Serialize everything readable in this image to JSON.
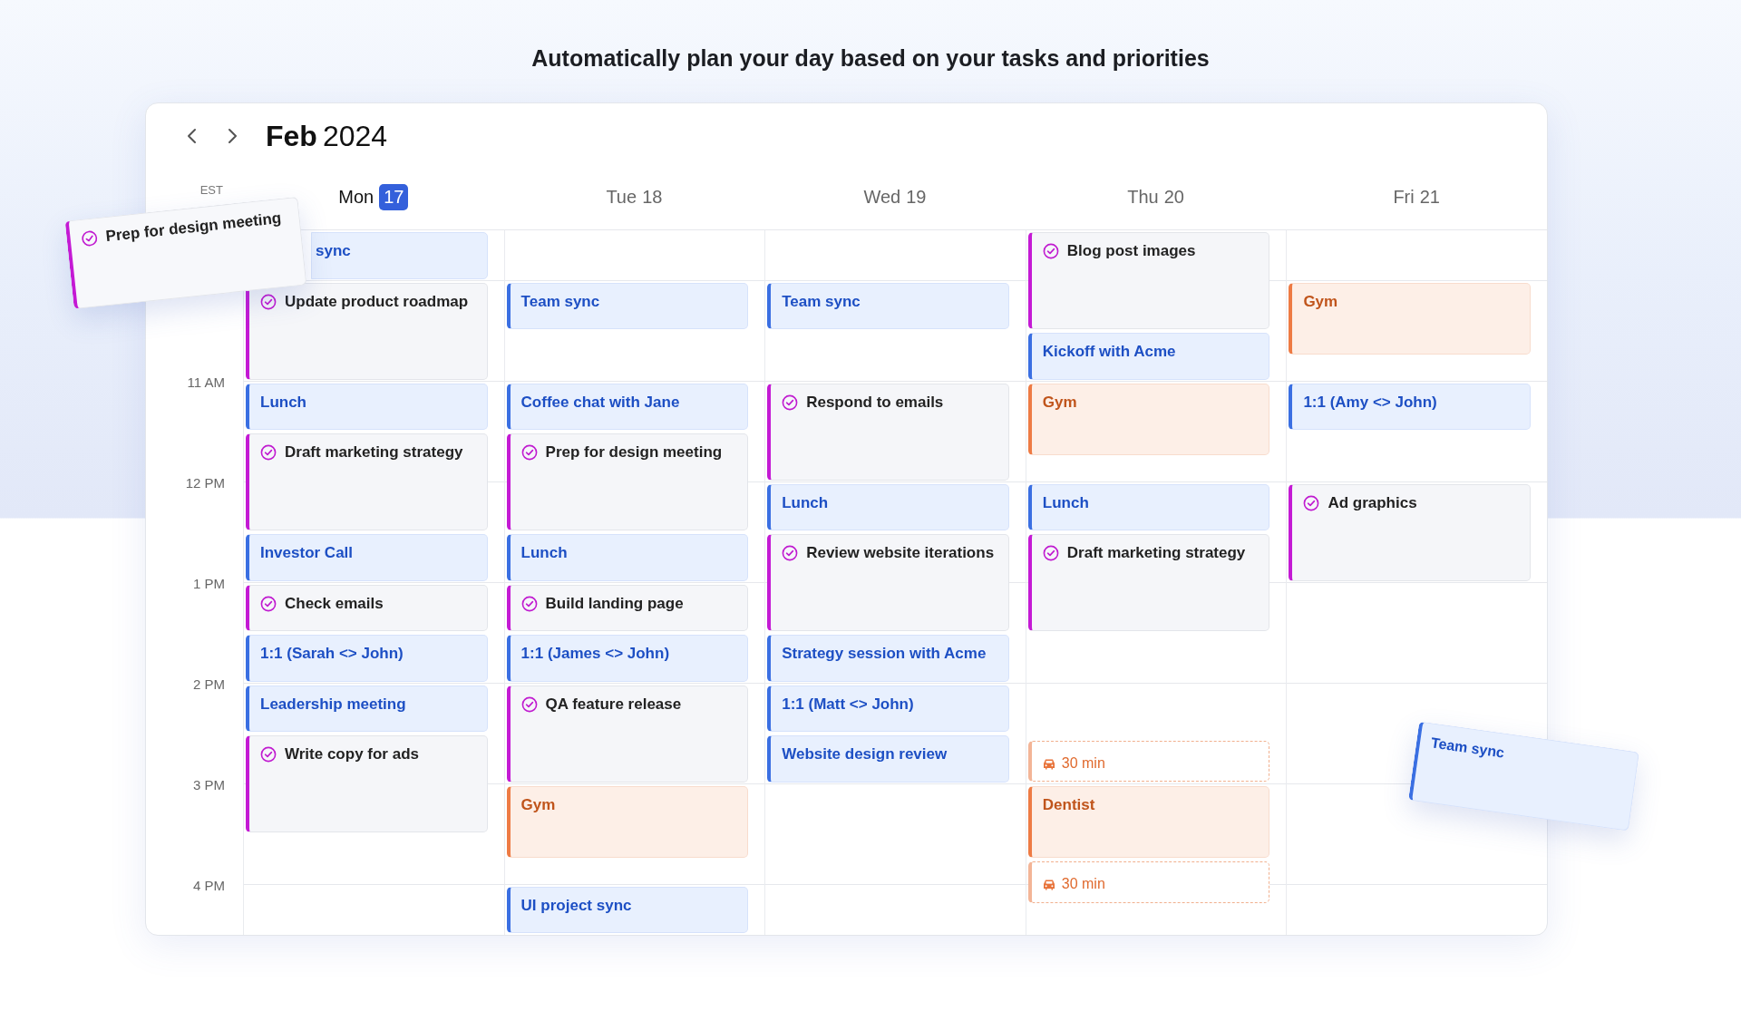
{
  "headline": "Automatically plan your day based on your tasks and priorities",
  "calendar": {
    "month": "Feb",
    "year": "2024",
    "timezone": "EST",
    "hours": [
      "11 AM",
      "12 PM",
      "1 PM",
      "2 PM",
      "3 PM",
      "4 PM"
    ],
    "days": [
      {
        "name": "Mon",
        "date": "17",
        "today": true,
        "events": [
          {
            "kind": "meeting",
            "title": "sync",
            "clipped": true
          },
          {
            "kind": "task",
            "title": "Update product roadmap"
          },
          {
            "kind": "meeting",
            "title": "Lunch"
          },
          {
            "kind": "task",
            "title": "Draft marketing strategy"
          },
          {
            "kind": "meeting",
            "title": "Investor Call"
          },
          {
            "kind": "task",
            "title": "Check emails"
          },
          {
            "kind": "meeting",
            "title": "1:1 (Sarah <> John)"
          },
          {
            "kind": "meeting",
            "title": "Leadership meeting"
          },
          {
            "kind": "task",
            "title": "Write copy for ads"
          }
        ]
      },
      {
        "name": "Tue",
        "date": "18",
        "today": false,
        "events": [
          {
            "kind": "meeting",
            "title": "Team sync"
          },
          {
            "kind": "meeting",
            "title": "Coffee chat with Jane"
          },
          {
            "kind": "task",
            "title": "Prep for design meeting"
          },
          {
            "kind": "meeting",
            "title": "Lunch"
          },
          {
            "kind": "task",
            "title": "Build landing page"
          },
          {
            "kind": "meeting",
            "title": "1:1 (James <> John)"
          },
          {
            "kind": "task",
            "title": "QA feature release"
          },
          {
            "kind": "personal",
            "title": "Gym"
          },
          {
            "kind": "meeting",
            "title": "UI project sync"
          }
        ]
      },
      {
        "name": "Wed",
        "date": "19",
        "today": false,
        "events": [
          {
            "kind": "meeting",
            "title": "Team sync"
          },
          {
            "kind": "task",
            "title": "Respond to emails"
          },
          {
            "kind": "meeting",
            "title": "Lunch"
          },
          {
            "kind": "task",
            "title": "Review website iterations"
          },
          {
            "kind": "meeting",
            "title": "Strategy session with Acme"
          },
          {
            "kind": "meeting",
            "title": "1:1 (Matt <> John)"
          },
          {
            "kind": "meeting",
            "title": "Website design review"
          }
        ]
      },
      {
        "name": "Thu",
        "date": "20",
        "today": false,
        "events": [
          {
            "kind": "task",
            "title": "Blog post images"
          },
          {
            "kind": "meeting",
            "title": "Kickoff with Acme"
          },
          {
            "kind": "personal",
            "title": "Gym"
          },
          {
            "kind": "meeting",
            "title": "Lunch"
          },
          {
            "kind": "task",
            "title": "Draft marketing strategy"
          },
          {
            "kind": "travel",
            "title": "30 min"
          },
          {
            "kind": "personal",
            "title": "Dentist"
          },
          {
            "kind": "travel",
            "title": "30 min"
          }
        ]
      },
      {
        "name": "Fri",
        "date": "21",
        "today": false,
        "events": [
          {
            "kind": "personal",
            "title": "Gym"
          },
          {
            "kind": "meeting",
            "title": "1:1 (Amy <> John)"
          },
          {
            "kind": "task",
            "title": "Ad graphics"
          }
        ]
      }
    ]
  },
  "dragged_cards": [
    {
      "kind": "task",
      "title": "Prep for design meeting"
    },
    {
      "kind": "meeting",
      "title": "Team sync"
    }
  ]
}
